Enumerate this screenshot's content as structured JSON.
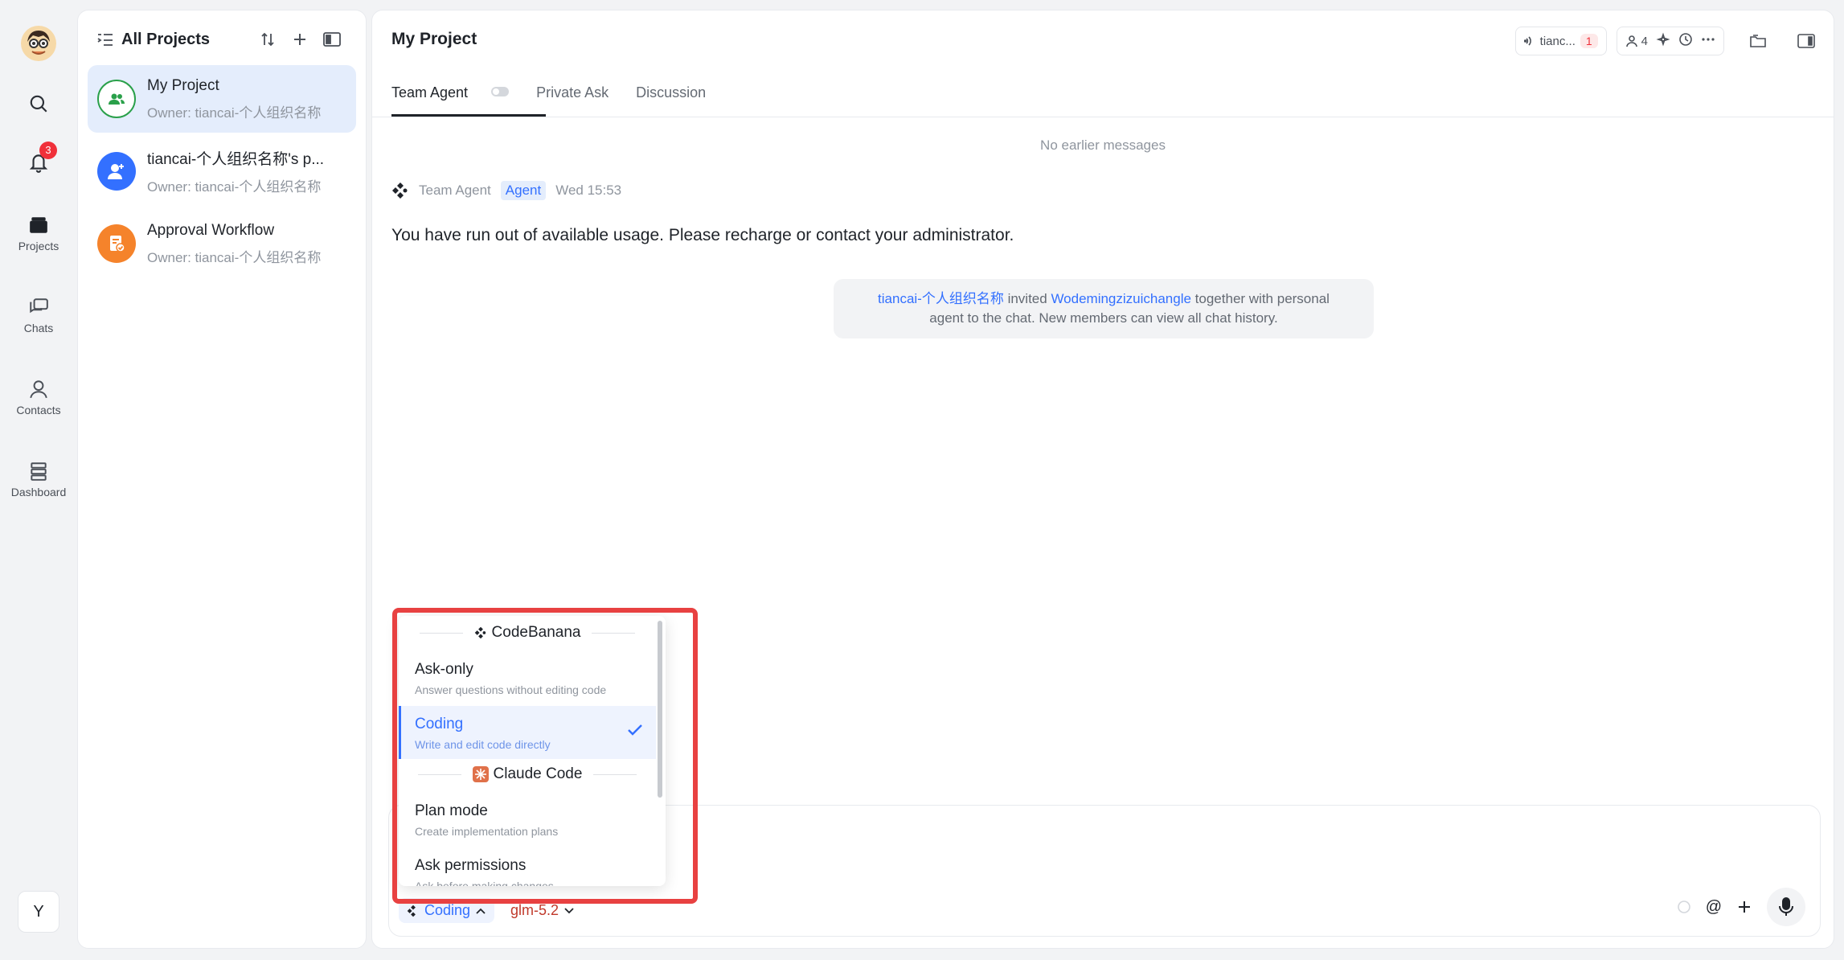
{
  "rail": {
    "badge_count": "3",
    "items": [
      {
        "label": "Projects"
      },
      {
        "label": "Chats"
      },
      {
        "label": "Contacts"
      },
      {
        "label": "Dashboard"
      }
    ],
    "user_initial": "Y"
  },
  "projects": {
    "title": "All Projects",
    "items": [
      {
        "name": "My Project",
        "owner": "Owner: tiancai-个人组织名称",
        "icon_color": "#2aa04a"
      },
      {
        "name": "tiancai-个人组织名称's p...",
        "owner": "Owner: tiancai-个人组织名称",
        "icon_color": "#3370ff"
      },
      {
        "name": "Approval Workflow",
        "owner": "Owner: tiancai-个人组织名称",
        "icon_color": "#f5832b"
      }
    ]
  },
  "main": {
    "title": "My Project",
    "top": {
      "agent_pill": "tianc...",
      "agent_count": "1",
      "members_count": "4"
    },
    "tabs": [
      "Team Agent",
      "Private Ask",
      "Discussion"
    ],
    "no_earlier": "No earlier messages",
    "message": {
      "sender": "Team Agent",
      "tag": "Agent",
      "time": "Wed 15:53",
      "text": "You have run out of available usage. Please recharge or contact your administrator."
    },
    "system_note": {
      "inviter": "tiancai-个人组织名称",
      "invited_word": " invited ",
      "invitee": "Wodemingzizuichangle",
      "rest_line1": " together with personal",
      "line2": "agent to the chat. New members can view all chat history."
    },
    "composer": {
      "mode": "Coding",
      "model": "glm-5.2"
    }
  },
  "dropdown": {
    "group1": "CodeBanana",
    "group2": "Claude Code",
    "options": [
      {
        "title": "Ask-only",
        "desc": "Answer questions without editing code"
      },
      {
        "title": "Coding",
        "desc": "Write and edit code directly",
        "selected": true
      },
      {
        "title": "Plan mode",
        "desc": "Create implementation plans"
      },
      {
        "title": "Ask permissions",
        "desc": "Ask before making changes"
      }
    ]
  },
  "colors": {
    "accent": "#3370ff",
    "highlight": "#e84141",
    "badge": "#f0303a"
  }
}
